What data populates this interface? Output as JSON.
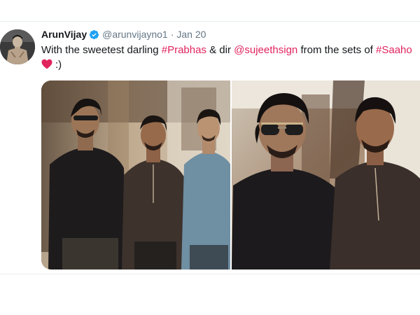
{
  "tweet": {
    "display_name": "ArunVijay",
    "handle": "@arunvijayno1",
    "separator": "·",
    "date": "Jan 20",
    "text": {
      "part1": "With the sweetest darling ",
      "hashtag1": "#Prabhas",
      "part2": " & dir ",
      "mention1": "@sujeethsign",
      "part3": " from the sets of ",
      "hashtag2": "#Saaho",
      "emoticon": ":)"
    },
    "icons": {
      "verified": "verified-badge-icon",
      "heart": "red-heart-emoji",
      "avatar": "profile-avatar"
    },
    "colors": {
      "link": "#e0245e",
      "verified": "#1da1f2",
      "heart": "#e0245e",
      "text": "#14171a",
      "muted": "#657786"
    },
    "media": [
      {
        "type": "photo",
        "subject": "three men posing on film set"
      },
      {
        "type": "photo",
        "subject": "two men selfie on film set"
      }
    ]
  }
}
